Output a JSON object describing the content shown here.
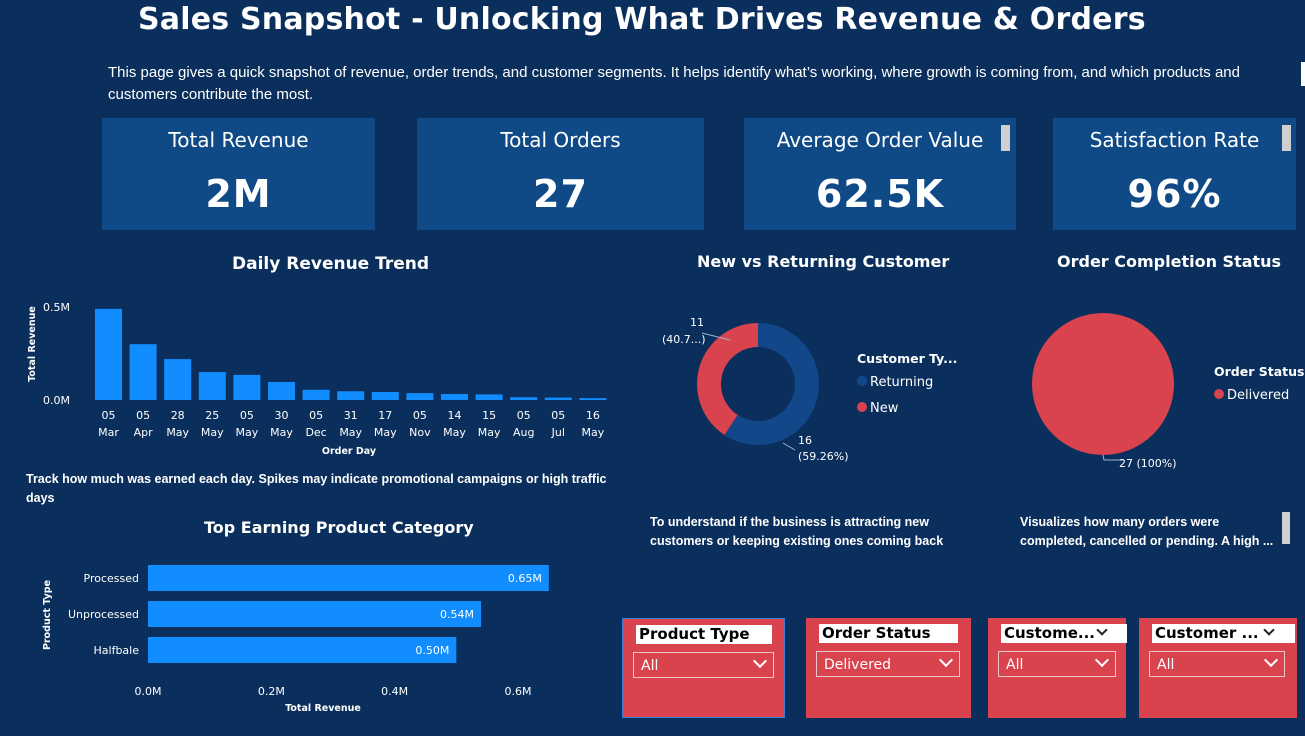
{
  "header": {
    "title": "Sales  Snapshot - Unlocking What Drives Revenue & Orders",
    "description": "This page gives a quick snapshot of revenue, order trends, and customer segments. It helps identify what’s working, where growth is coming from,  and which products and customers contribute the most."
  },
  "kpis": [
    {
      "label": "Total Revenue",
      "value": "2M"
    },
    {
      "label": "Total Orders",
      "value": "27"
    },
    {
      "label": "Average Order Value",
      "value": "62.5K"
    },
    {
      "label": "Satisfaction Rate",
      "value": "96%"
    }
  ],
  "daily_trend": {
    "title": "Daily Revenue Trend",
    "note": "Track how much was earned each day. Spikes may indicate promotional campaigns or high traffic days"
  },
  "top_category": {
    "title": "Top Earning Product Category"
  },
  "customer_chart": {
    "title": "New vs Returning Customer",
    "note": "To understand if the business is attracting new customers or keeping existing ones coming back",
    "legend_title": "Customer Ty...",
    "label_new_count": "11",
    "label_new_pct": "(40.7...)",
    "label_ret_count": "16",
    "label_ret_pct": "(59.26%)"
  },
  "status_chart": {
    "title": "Order Completion Status",
    "note": "Visualizes how many orders were completed, cancelled or pending. A high ...",
    "legend_title": "Order Status",
    "slice_label": "27 (100%)"
  },
  "slicers": [
    {
      "header": "Product Type",
      "value": "All"
    },
    {
      "header": "Order Status",
      "value": "Delivered"
    },
    {
      "header": "Custome...",
      "value": "All"
    },
    {
      "header": "Customer ...",
      "value": "All"
    }
  ],
  "colors": {
    "accent": "#118dff",
    "new": "#d9434d",
    "returning": "#12478a",
    "background": "#0b2f5c",
    "tile": "#0f4a86"
  },
  "chart_data": [
    {
      "type": "bar",
      "title": "Daily Revenue Trend",
      "xlabel": "Order Day",
      "ylabel": "Total Revenue",
      "categories": [
        [
          "05",
          "Mar"
        ],
        [
          "05",
          "Apr"
        ],
        [
          "28",
          "May"
        ],
        [
          "25",
          "May"
        ],
        [
          "05",
          "May"
        ],
        [
          "30",
          "May"
        ],
        [
          "05",
          "Dec"
        ],
        [
          "31",
          "May"
        ],
        [
          "17",
          "May"
        ],
        [
          "05",
          "Nov"
        ],
        [
          "14",
          "May"
        ],
        [
          "15",
          "May"
        ],
        [
          "05",
          "Aug"
        ],
        [
          "05",
          "Jul"
        ],
        [
          "16",
          "May"
        ]
      ],
      "values": [
        0.49,
        0.3,
        0.22,
        0.15,
        0.135,
        0.097,
        0.055,
        0.047,
        0.043,
        0.037,
        0.032,
        0.03,
        0.015,
        0.013,
        0.01
      ],
      "y_ticks": [
        "0.0M",
        "0.5M"
      ],
      "ylim": [
        0,
        0.5
      ]
    },
    {
      "type": "bar",
      "orientation": "horizontal",
      "title": "Top Earning Product Category",
      "xlabel": "Total Revenue",
      "ylabel": "Product Type",
      "categories": [
        "Processed",
        "Unprocessed",
        "Halfbale"
      ],
      "values": [
        0.65,
        0.54,
        0.5
      ],
      "value_labels": [
        "0.65M",
        "0.54M",
        "0.50M"
      ],
      "x_ticks": [
        "0.0M",
        "0.2M",
        "0.4M",
        "0.6M"
      ],
      "xlim": [
        0,
        0.6
      ]
    },
    {
      "type": "pie",
      "title": "New vs Returning Customer",
      "legend": [
        "Returning",
        "New"
      ],
      "values": [
        16,
        11
      ],
      "percent": [
        59.26,
        40.74
      ]
    },
    {
      "type": "pie",
      "title": "Order Completion Status",
      "legend": [
        "Delivered"
      ],
      "values": [
        27
      ],
      "percent": [
        100
      ]
    }
  ]
}
